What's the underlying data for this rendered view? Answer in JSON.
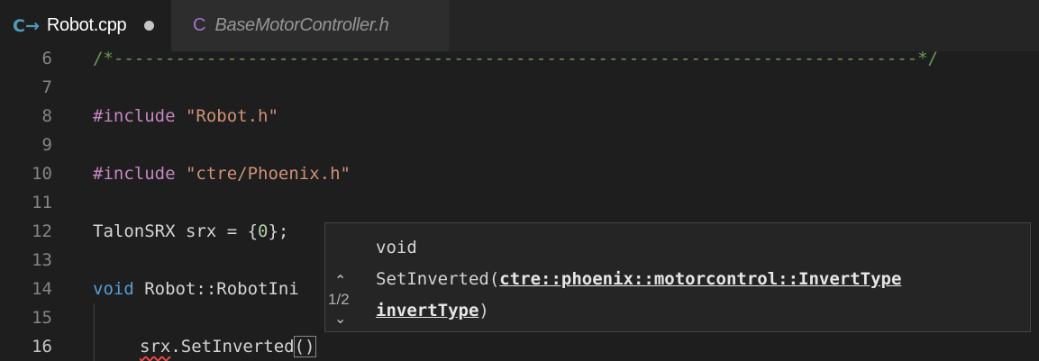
{
  "tabs": [
    {
      "icon": "C→",
      "label": "Robot.cpp",
      "active": true,
      "dirty": true
    },
    {
      "icon": "C",
      "label": "BaseMotorController.h",
      "active": false
    }
  ],
  "editor": {
    "lines": [
      {
        "num": "6",
        "text": "/*------------------------------------------------------------------------------*/"
      },
      {
        "num": "7",
        "text": ""
      },
      {
        "num": "8",
        "dir": "#include",
        "str": " \"Robot.h\""
      },
      {
        "num": "9",
        "text": ""
      },
      {
        "num": "10",
        "dir": "#include",
        "str": " \"ctre/Phoenix.h\""
      },
      {
        "num": "11",
        "text": ""
      },
      {
        "num": "12",
        "pre": "TalonSRX srx = {",
        "numlit": "0",
        "post": "};"
      },
      {
        "num": "13",
        "text": ""
      },
      {
        "num": "14",
        "kw": "void",
        "rest": " Robot::RobotIni"
      },
      {
        "num": "15",
        "text": ""
      },
      {
        "num": "16",
        "obj": "srx",
        "call": ".SetInverted",
        "bracket": "()"
      }
    ]
  },
  "hover": {
    "counter": "1/2",
    "return_type": "void",
    "func_name": "SetInverted(",
    "param_type": "ctre::phoenix::motorcontrol::InvertType",
    "param_name": "invertType",
    "close": ")"
  }
}
